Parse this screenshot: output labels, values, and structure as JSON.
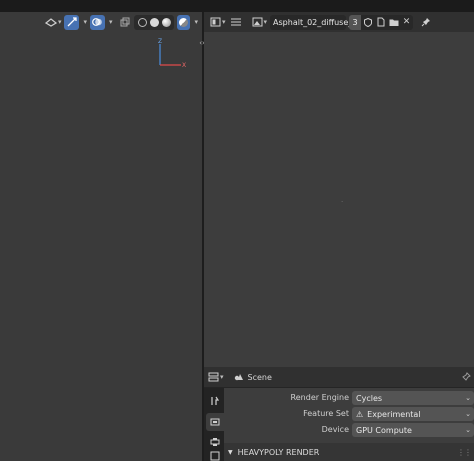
{
  "colors": {
    "viewport_bg": "#3a3a3a",
    "editor_bg": "#3d3d3d",
    "accent": "#4772b3",
    "props_bg": "#2e2e2e"
  },
  "viewport": {
    "header_icons": [
      "orientation-icon",
      "visibility-icon",
      "gizmo-icon",
      "overlay-icon",
      "xray-icon",
      "wireframe-icon",
      "solid-icon",
      "material-icon",
      "rendered-icon"
    ],
    "gizmo": {
      "z_label": "Z",
      "x_label": "X"
    }
  },
  "editor": {
    "image_name": "Asphalt_02_diffuse_...",
    "user_count": "3",
    "icons": [
      "image-editor-icon",
      "menu-icon",
      "image-icon",
      "fake-user-icon",
      "new-image-icon",
      "open-folder-icon",
      "close-icon",
      "pin-icon"
    ]
  },
  "properties": {
    "context": "Scene",
    "rows": [
      {
        "label": "Render Engine",
        "value": "Cycles"
      },
      {
        "label": "Feature Set",
        "value": "Experimental"
      },
      {
        "label": "Device",
        "value": "GPU Compute"
      }
    ],
    "panel_title": "HEAVYPOLY RENDER"
  }
}
